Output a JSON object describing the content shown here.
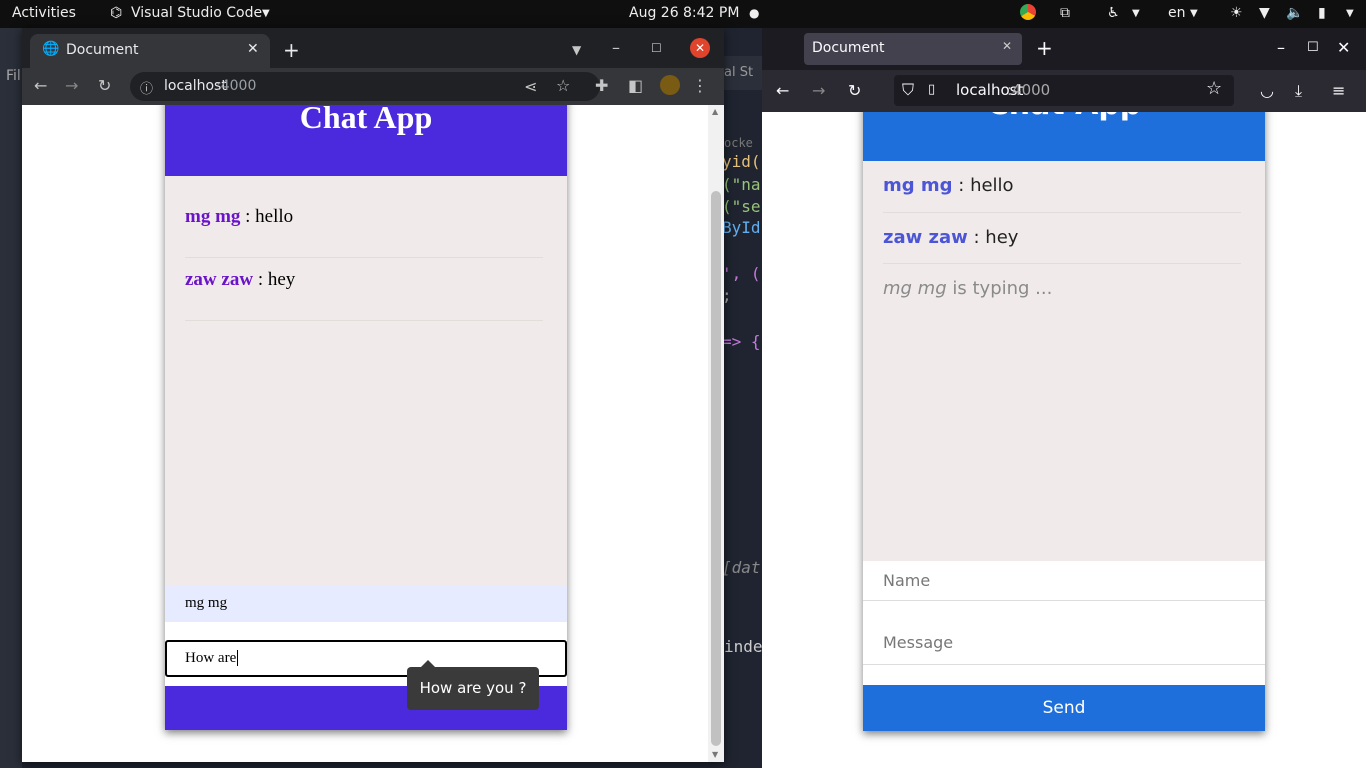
{
  "topbar": {
    "activities": "Activities",
    "app_name": "Visual Studio Code",
    "date": "Aug 26",
    "time": "8:42 PM",
    "lang": "en"
  },
  "vscode": {
    "menu_fragment": "Fil",
    "title_fragment": "al St",
    "code_lines": [
      "ocke",
      "yid(",
      "(\"na",
      "(\"se",
      "ById",
      "', (",
      ";",
      "=> {",
      "[dat",
      "inde"
    ]
  },
  "chrome": {
    "tab_title": "Document",
    "url_host": "localhost",
    "url_port": ":4000",
    "chat": {
      "title": "Chat App",
      "messages": [
        {
          "user": "mg mg",
          "text": " : hello"
        },
        {
          "user": "zaw zaw",
          "text": " : hey"
        }
      ],
      "name_value": "mg mg",
      "message_value": "How are",
      "autocomplete_suggestion": "How are you ?"
    }
  },
  "firefox": {
    "tab_title": "Document",
    "url_host": "localhost",
    "url_port": ":4000",
    "chat": {
      "title": "Chat App",
      "messages": [
        {
          "user": "mg mg",
          "text": " : hello"
        },
        {
          "user": "zaw zaw",
          "text": " : hey"
        }
      ],
      "typing_user": "mg mg",
      "typing_text": " is typing ...",
      "name_placeholder": "Name",
      "message_placeholder": "Message",
      "send_label": "Send"
    }
  },
  "colors": {
    "chrome_chat_accent": "#4b29dd",
    "firefox_chat_accent": "#1e6fdc",
    "chat_bg": "#f0ebea"
  }
}
